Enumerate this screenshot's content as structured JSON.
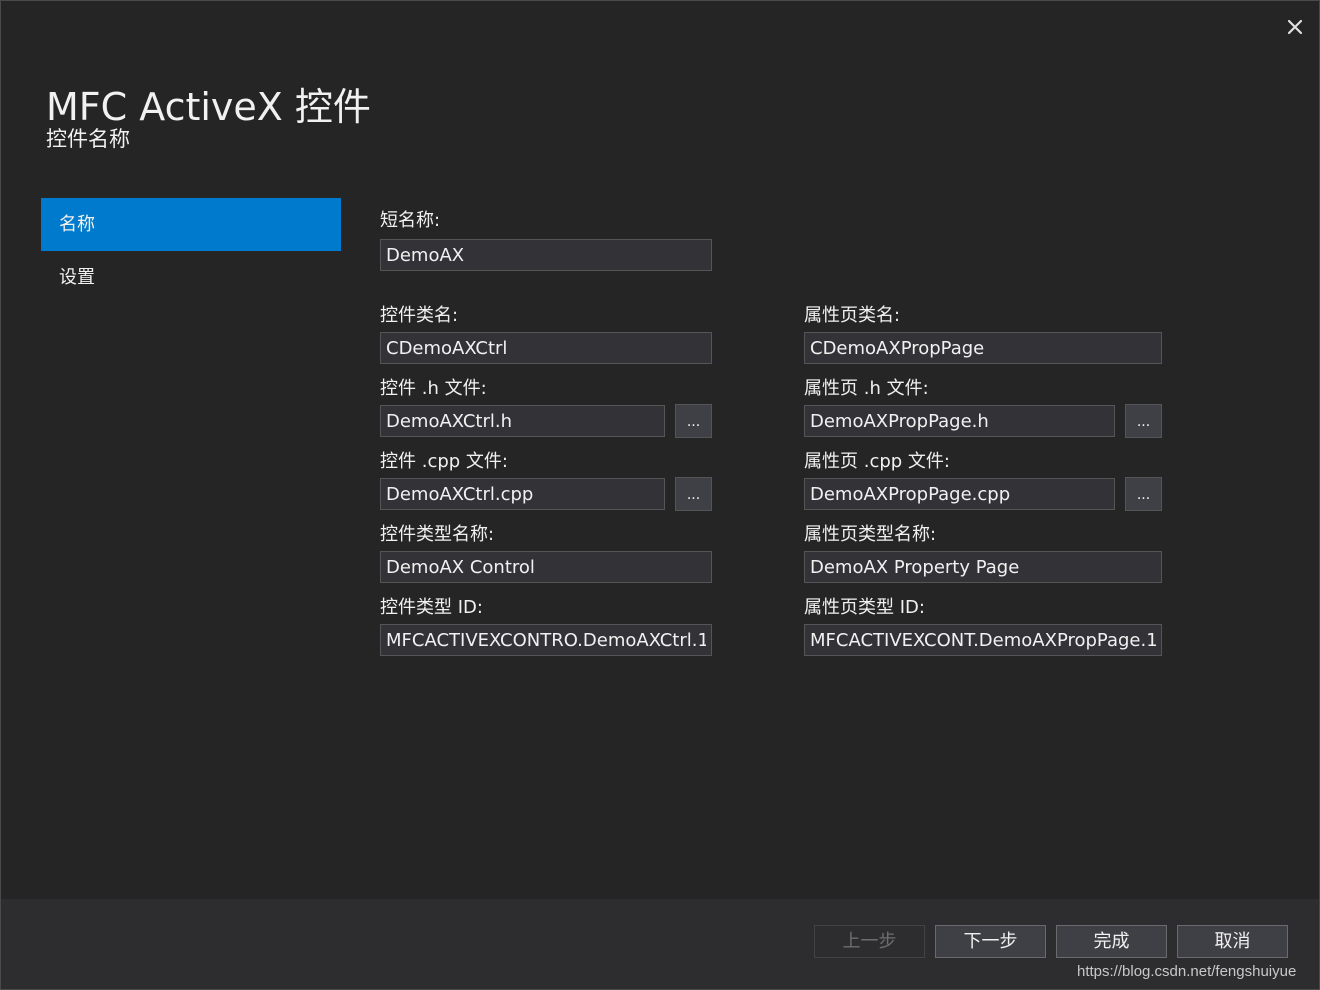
{
  "window": {
    "title": "MFC ActiveX 控件",
    "subtitle": "控件名称"
  },
  "nav": {
    "items": [
      {
        "label": "名称",
        "active": true
      },
      {
        "label": "设置",
        "active": false
      }
    ]
  },
  "form": {
    "short_name": {
      "label": "短名称:",
      "value": "DemoAX"
    },
    "control_class": {
      "label": "控件类名:",
      "value": "CDemoAXCtrl"
    },
    "control_h": {
      "label": "控件 .h 文件:",
      "value": "DemoAXCtrl.h"
    },
    "control_cpp": {
      "label": "控件 .cpp 文件:",
      "value": "DemoAXCtrl.cpp"
    },
    "control_type_name": {
      "label": "控件类型名称:",
      "value": "DemoAX Control"
    },
    "control_type_id": {
      "label": "控件类型 ID:",
      "value": "MFCACTIVEXCONTRO.DemoAXCtrl.1"
    },
    "proppage_class": {
      "label": "属性页类名:",
      "value": "CDemoAXPropPage"
    },
    "proppage_h": {
      "label": "属性页 .h 文件:",
      "value": "DemoAXPropPage.h"
    },
    "proppage_cpp": {
      "label": "属性页 .cpp 文件:",
      "value": "DemoAXPropPage.cpp"
    },
    "proppage_type_name": {
      "label": "属性页类型名称:",
      "value": "DemoAX Property Page"
    },
    "proppage_type_id": {
      "label": "属性页类型 ID:",
      "value": "MFCACTIVEXCONT.DemoAXPropPage.1"
    },
    "browse_label": "..."
  },
  "footer": {
    "prev": "上一步",
    "next": "下一步",
    "finish": "完成",
    "cancel": "取消"
  },
  "watermark": "https://blog.csdn.net/fengshuiyue",
  "colors": {
    "background": "#252526",
    "accent": "#007acc",
    "field_bg": "#333337",
    "footer_bg": "#2d2d30"
  },
  "icons": {
    "close": "close-icon"
  }
}
